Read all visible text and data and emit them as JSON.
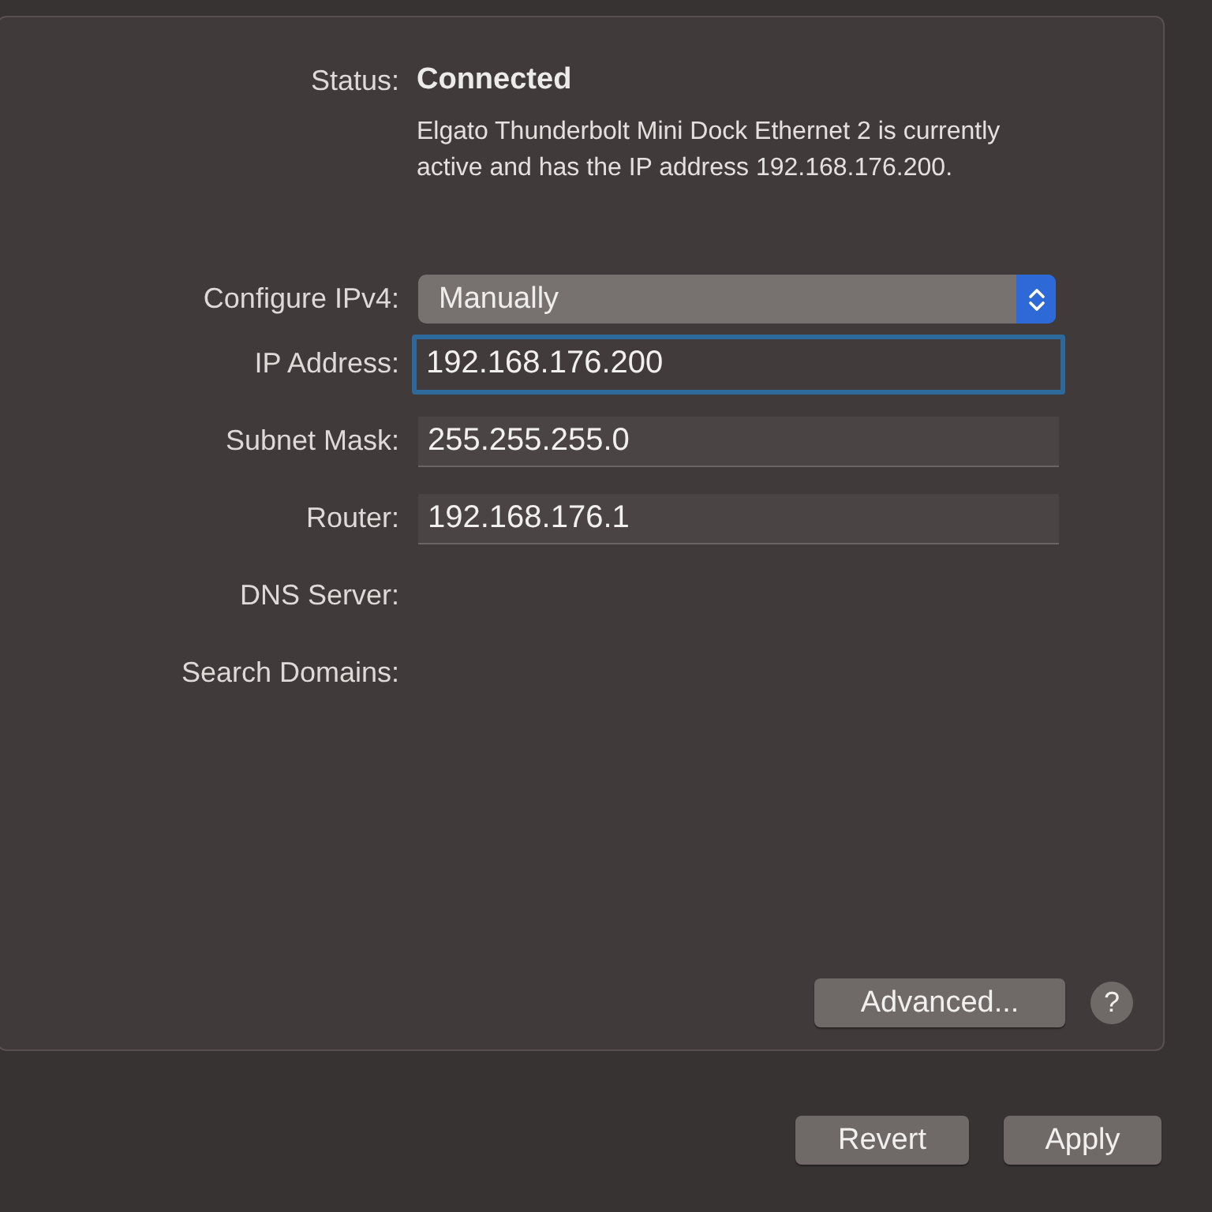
{
  "status": {
    "label": "Status:",
    "value": "Connected",
    "description": "Elgato Thunderbolt Mini Dock Ethernet 2 is currently active and has the IP address 192.168.176.200."
  },
  "rows": [
    {
      "kind": "popup",
      "label": "Configure IPv4:",
      "value": "Manually"
    },
    {
      "kind": "field",
      "label": "IP Address:",
      "value": "192.168.176.200",
      "focused": true
    },
    {
      "kind": "field",
      "label": "Subnet Mask:",
      "value": "255.255.255.0",
      "focused": false
    },
    {
      "kind": "field",
      "label": "Router:",
      "value": "192.168.176.1",
      "focused": false
    },
    {
      "kind": "empty",
      "label": "DNS Server:"
    },
    {
      "kind": "empty",
      "label": "Search Domains:"
    }
  ],
  "advanced_button": "Advanced...",
  "help_button": "?",
  "buttons": [
    "Revert",
    "Apply"
  ]
}
